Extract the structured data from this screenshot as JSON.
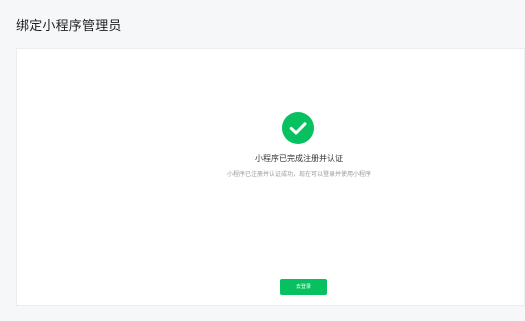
{
  "page": {
    "title": "绑定小程序管理员"
  },
  "result": {
    "icon": "check-circle-icon",
    "title": "小程序已完成注册并认证",
    "description": "小程序已注册并认证成功，现在可以登录并使用小程序",
    "button_label": "去登录",
    "accent_color": "#07c160"
  }
}
